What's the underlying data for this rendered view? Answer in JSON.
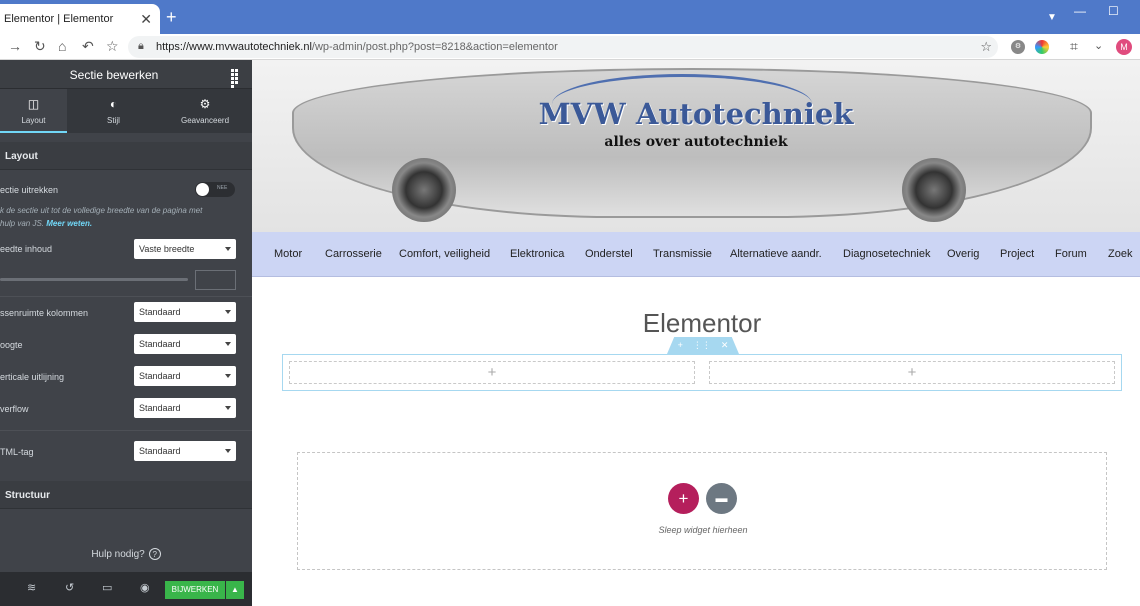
{
  "browser": {
    "tab_title": "Elementor | Elementor",
    "tab_close": "✕",
    "new_tab": "+",
    "url_host": "https://www.mvwautotechniek.nl",
    "url_path": "/wp-admin/post.php?post=8218&action=elementor",
    "avatar_letter": "M"
  },
  "panel": {
    "title": "Sectie bewerken",
    "tabs": [
      {
        "label": "Layout",
        "icon": "layout-icon"
      },
      {
        "label": "Stijl",
        "icon": "contrast-icon"
      },
      {
        "label": "Geavanceerd",
        "icon": "gear-icon"
      }
    ],
    "layout_heading": "Layout",
    "stretch_label": "ectie uitrekken",
    "stretch_state": "NEE",
    "stretch_desc": "k de sectie uit tot de volledige breedte van de pagina met",
    "stretch_desc2": "hulp van JS.",
    "stretch_link": "Meer weten.",
    "content_width_label": "eedte inhoud",
    "content_width_value": "Vaste breedte",
    "column_gap_label": "ssenruimte kolommen",
    "column_gap_value": "Standaard",
    "height_label": "oogte",
    "height_value": "Standaard",
    "vertical_align_label": "erticale uitlijning",
    "vertical_align_value": "Standaard",
    "overflow_label": "verflow",
    "overflow_value": "Standaard",
    "html_tag_label": "TML-tag",
    "html_tag_value": "Standaard",
    "structure_heading": "Structuur",
    "help_text": "Hulp nodig?",
    "update_label": "BIJWERKEN"
  },
  "site": {
    "logo_title": "MVW Autotechniek",
    "logo_subtitle": "alles over autotechniek",
    "menu": [
      "Motor",
      "Carrosserie",
      "Comfort, veiligheid",
      "Elektronica",
      "Onderstel",
      "Transmissie",
      "Alternatieve aandr.",
      "Diagnosetechniek",
      "Overig",
      "Project",
      "Forum",
      "Zoek"
    ]
  },
  "canvas": {
    "page_title": "Elementor",
    "drop_hint": "Sleep widget hierheen"
  },
  "colors": {
    "accent": "#71d7f7",
    "update": "#39b54a",
    "add": "#b51f5c",
    "menu_bg": "#ccd5f4"
  }
}
